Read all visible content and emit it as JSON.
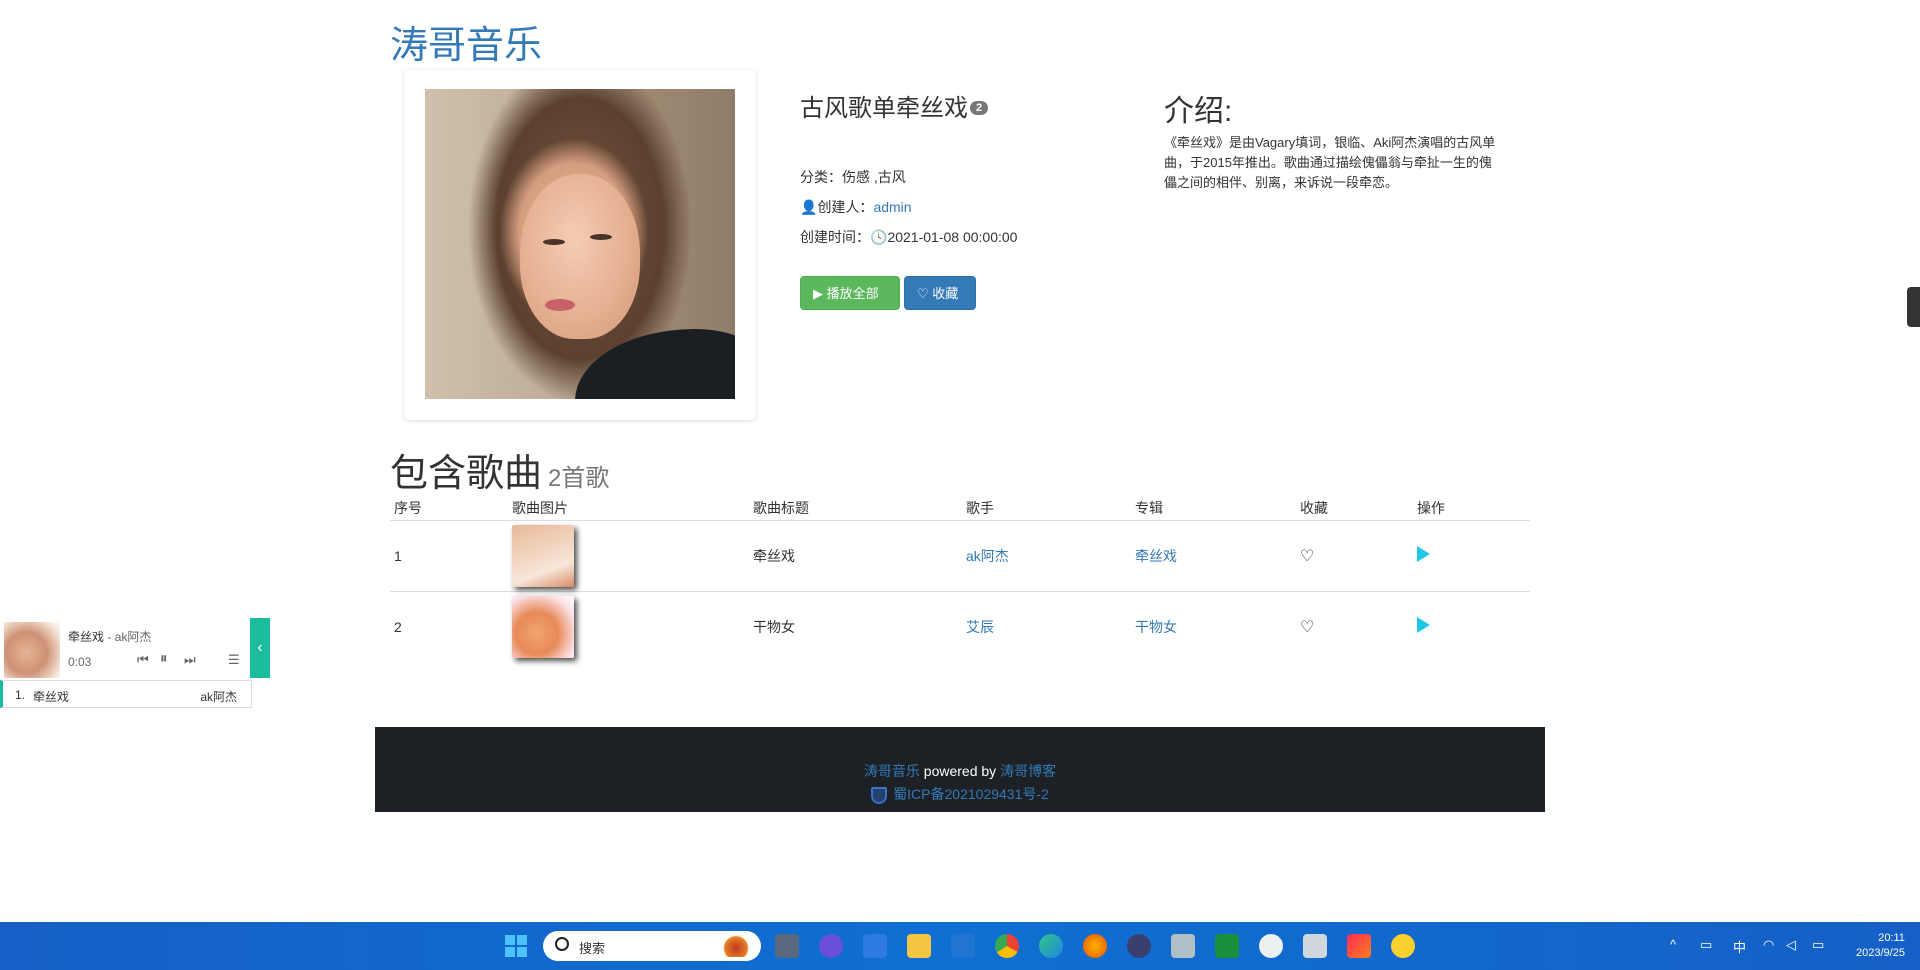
{
  "brand": "涛哥音乐",
  "playlist": {
    "title": "古风歌单牵丝戏",
    "badge": "2",
    "category_label": "分类：",
    "category_value": "伤感 ,古风",
    "creator_label": "创建人：",
    "creator": "admin",
    "created_label": "创建时间：",
    "created_time": "2021-01-08 00:00:00",
    "play_all_label": "播放全部",
    "favorite_label": "收藏"
  },
  "intro": {
    "heading": "介绍:",
    "text": "《牵丝戏》是由Vagary填词，银临、Aki阿杰演唱的古风单曲，于2015年推出。歌曲通过描绘傀儡翁与牵扯一生的傀儡之间的相伴、别离，来诉说一段牵恋。"
  },
  "songs_section": {
    "heading": "包含歌曲",
    "count_label": "2首歌",
    "columns": [
      "序号",
      "歌曲图片",
      "歌曲标题",
      "歌手",
      "专辑",
      "收藏",
      "操作"
    ],
    "rows": [
      {
        "index": "1",
        "title": "牵丝戏",
        "singer": "ak阿杰",
        "album": "牵丝戏"
      },
      {
        "index": "2",
        "title": "干物女",
        "singer": "艾辰",
        "album": "干物女"
      }
    ]
  },
  "footer": {
    "site": "涛哥音乐",
    "powered_by": " powered by ",
    "blog": "涛哥博客",
    "icp": "蜀ICP备2021029431号-2"
  },
  "player": {
    "now_title": "牵丝戏",
    "now_sep": " - ",
    "now_artist": "ak阿杰",
    "time": "0:03",
    "list": [
      {
        "num": "1.",
        "name": "牵丝戏",
        "artist": "ak阿杰"
      }
    ]
  },
  "taskbar": {
    "search_placeholder": "搜索",
    "ime": "中",
    "time": "20:11",
    "date": "2023/9/25"
  },
  "colors": {
    "brand": "#337ab7",
    "play_button": "#5cb85c",
    "favorite_button": "#337ab7",
    "player_accent": "#1abc9c",
    "footer_bg": "#1d2126",
    "play_icon": "#1ec8e6",
    "taskbar": "#1560c6"
  }
}
